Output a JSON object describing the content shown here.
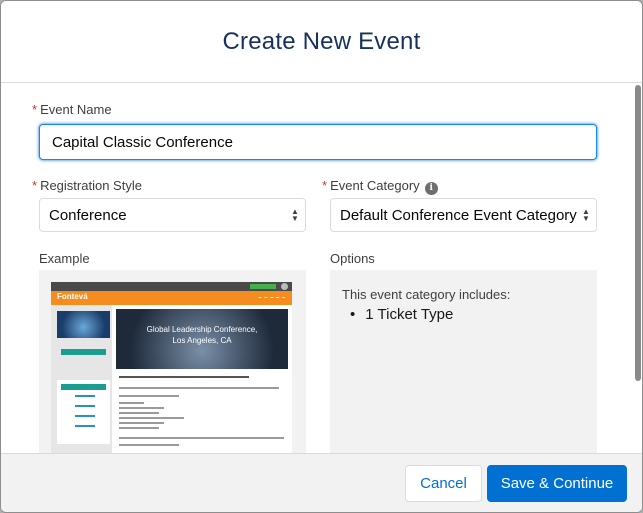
{
  "modal": {
    "title": "Create New Event"
  },
  "form": {
    "event_name": {
      "label": "Event Name",
      "value": "Capital Classic Conference"
    },
    "registration_style": {
      "label": "Registration Style",
      "selected": "Conference"
    },
    "event_category": {
      "label": "Event Category",
      "selected": "Default Conference Event Category",
      "info_icon": "info-icon"
    },
    "example": {
      "label": "Example"
    },
    "options": {
      "label": "Options",
      "intro": "This event category includes:",
      "items": [
        "1  Ticket Type"
      ]
    }
  },
  "preview": {
    "logo": "Fontevá",
    "hero_line1": "Global Leadership Conference,",
    "hero_line2": "Los Angeles, CA"
  },
  "footer": {
    "cancel_label": "Cancel",
    "save_label": "Save & Continue"
  },
  "colors": {
    "brand": "#0070d2",
    "required": "#c23934",
    "focus": "#1589ee"
  }
}
